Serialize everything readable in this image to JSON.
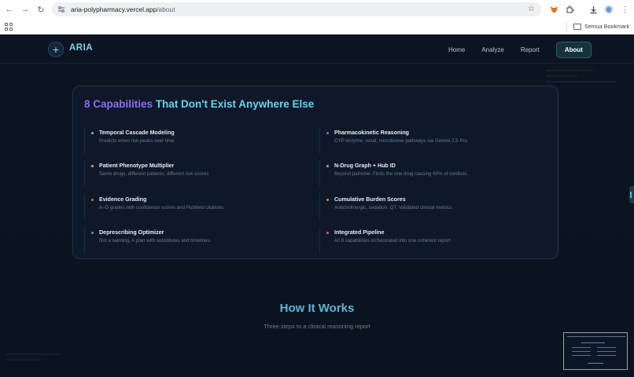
{
  "browser": {
    "url_host": "aria-polypharmacy.vercel.app",
    "url_path": "/about",
    "bookmarks_label": "Semua Bookmark"
  },
  "header": {
    "logo_symbol": "+",
    "logo": "ARIA",
    "nav": [
      "Home",
      "Analyze",
      "Report",
      "About"
    ],
    "active_nav": "About"
  },
  "capabilities": {
    "title_part1": "8 Capabilities",
    "title_part2": "That Don't Exist Anywhere Else",
    "items": [
      {
        "title": "Temporal Cascade Modeling",
        "desc": "Predicts when risk peaks over time",
        "color": "#5ec8d8"
      },
      {
        "title": "Pharmacokinetic Reasoning",
        "desc": "CYP enzyme, renal, microbiome pathways via Gemini 2.5 Pro",
        "color": "#8b6cf6"
      },
      {
        "title": "Patient Phenotype Multiplier",
        "desc": "Same drugs, different patients, different risk scores",
        "color": "#e0b04a"
      },
      {
        "title": "N-Drug Graph + Hub ID",
        "desc": "Beyond pairwise. Finds the one drug causing 60% of conflicts.",
        "color": "#4fd1a5"
      },
      {
        "title": "Evidence Grading",
        "desc": "A–D grades with confidence scores and PubMed citations",
        "color": "#e0605a"
      },
      {
        "title": "Cumulative Burden Scores",
        "desc": "Anticholinergic, sedation, QT. Validated clinical metrics.",
        "color": "#e8894a"
      },
      {
        "title": "Deprescribing Optimizer",
        "desc": "Not a warning. A plan with substitutes and timelines.",
        "color": "#5b8def"
      },
      {
        "title": "Integrated Pipeline",
        "desc": "All 8 capabilities orchestrated into one coherent report",
        "color": "#e05a7a"
      }
    ]
  },
  "how_it_works": {
    "title": "How It Works",
    "subtitle": "Three steps to a clinical reasoning report"
  }
}
